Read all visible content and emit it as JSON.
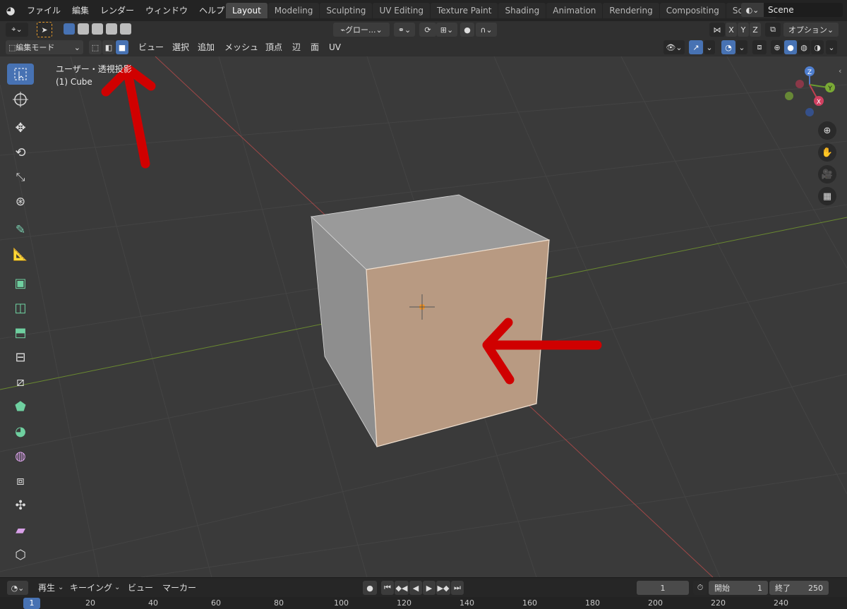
{
  "topbar": {
    "menus": [
      "ファイル",
      "編集",
      "レンダー",
      "ウィンドウ",
      "ヘルプ"
    ],
    "workspaces": [
      "Layout",
      "Modeling",
      "Sculpting",
      "UV Editing",
      "Texture Paint",
      "Shading",
      "Animation",
      "Rendering",
      "Compositing",
      "Scripting"
    ],
    "active_workspace": "Layout",
    "scene": "Scene"
  },
  "header1": {
    "transform_orientation": "グロー...",
    "axes": [
      "X",
      "Y",
      "Z"
    ],
    "options": "オプション"
  },
  "header2": {
    "mode": "編集モード",
    "menus": [
      "ビュー",
      "選択",
      "追加",
      "メッシュ",
      "頂点",
      "辺",
      "面",
      "UV"
    ]
  },
  "viewport": {
    "view_name": "ユーザー・透視投影",
    "object_name": "(1) Cube",
    "gizmo_axes": {
      "z": "Z",
      "y": "Y",
      "x": "X"
    }
  },
  "timeline": {
    "menus": [
      "再生",
      "キーイング",
      "ビュー",
      "マーカー"
    ],
    "current_frame": "1",
    "start_label": "開始",
    "start_value": "1",
    "end_label": "終了",
    "end_value": "250"
  },
  "ruler": {
    "current": "1",
    "ticks": [
      "20",
      "40",
      "60",
      "80",
      "100",
      "120",
      "140",
      "160",
      "180",
      "200",
      "220",
      "240"
    ]
  },
  "colors": {
    "accent": "#4772b3",
    "selected_face": "#b89a82",
    "annotation_arrow": "#d00000"
  }
}
